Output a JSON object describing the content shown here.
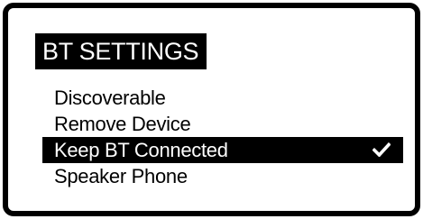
{
  "header": {
    "title": "BT SETTINGS"
  },
  "menu": {
    "items": [
      {
        "label": "Discoverable",
        "selected": false,
        "checked": false
      },
      {
        "label": "Remove Device",
        "selected": false,
        "checked": false
      },
      {
        "label": "Keep BT Connected",
        "selected": true,
        "checked": true
      },
      {
        "label": "Speaker Phone",
        "selected": false,
        "checked": false
      }
    ]
  },
  "colors": {
    "background": "#ffffff",
    "foreground": "#000000",
    "highlight": "#000000",
    "highlight_text": "#ffffff"
  },
  "icons": {
    "checked_item": "checkmark-icon"
  }
}
